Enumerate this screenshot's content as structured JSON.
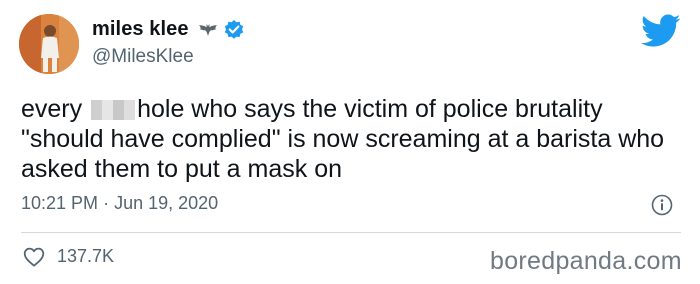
{
  "tweet": {
    "display_name": "miles klee",
    "handle": "@MilesKlee",
    "text_before_censor": "every ",
    "text_after_censor": "hole who says the victim of police brutality \"should have complied\" is now screaming at a barista who asked them to put a mask on",
    "time": "10:21 PM",
    "separator": "·",
    "date": "Jun 19, 2020",
    "likes": "137.7K"
  },
  "icons": {
    "name_badge": "bat-emoji-icon",
    "verified": "verified-badge-icon",
    "brand": "twitter-bird-icon",
    "info": "info-icon",
    "like": "heart-outline-icon"
  },
  "colors": {
    "twitter_blue": "#1d9bf0",
    "secondary_text": "#536471",
    "watermark": "#707a83"
  },
  "watermark": "boredpanda.com"
}
